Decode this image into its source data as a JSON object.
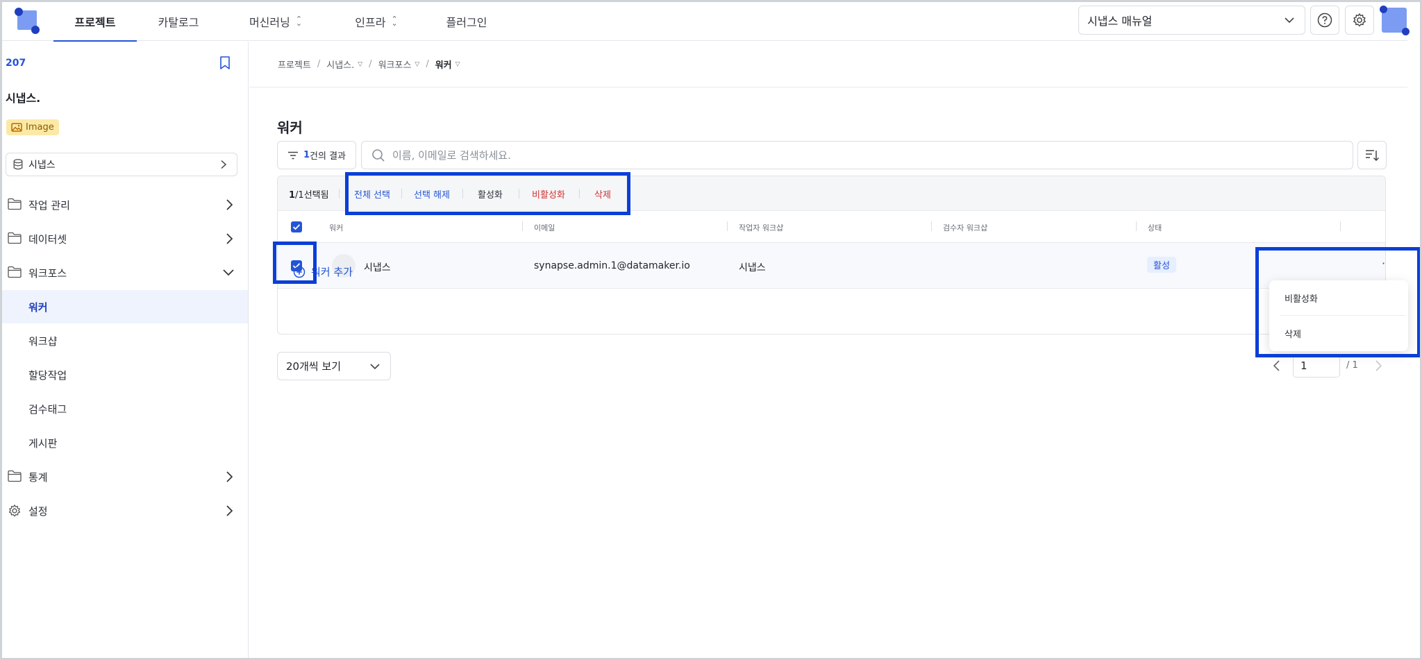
{
  "header": {
    "nav": [
      {
        "label": "프로젝트",
        "active": true,
        "dropdown": false
      },
      {
        "label": "카탈로그",
        "active": false,
        "dropdown": false
      },
      {
        "label": "머신러닝",
        "active": false,
        "dropdown": true
      },
      {
        "label": "인프라",
        "active": false,
        "dropdown": true
      },
      {
        "label": "플러그인",
        "active": false,
        "dropdown": false
      }
    ],
    "manual_select": "시냅스 매뉴얼"
  },
  "sidebar": {
    "project_id": "207",
    "project_name": "시냅스.",
    "badge": "Image",
    "dataset": "시냅스",
    "items": {
      "jobs": "작업 관리",
      "datasets": "데이터셋",
      "workforce": "워크포스",
      "workers": "워커",
      "workshops": "워크샵",
      "assignments": "할당작업",
      "review_tags": "검수태그",
      "board": "게시판",
      "stats": "통계",
      "settings": "설정"
    }
  },
  "breadcrumb": [
    "프로젝트",
    "시냅스.",
    "워크포스",
    "워커"
  ],
  "main": {
    "title": "워커",
    "filter": {
      "count": "1",
      "suffix": "건의 결과"
    },
    "search_placeholder": "이름, 이메일로 검색하세요.",
    "selection": {
      "selected": "1",
      "total": "/1",
      "suffix": "선택됨"
    },
    "bulk_actions": {
      "select_all": "전체 선택",
      "deselect": "선택 해제",
      "activate": "활성화",
      "deactivate": "비활성화",
      "delete": "삭제"
    },
    "columns": {
      "worker": "워커",
      "email": "이메일",
      "worker_workshop": "작업자 워크샵",
      "reviewer_workshop": "검수자 워크샵",
      "status": "상태"
    },
    "rows": [
      {
        "name": "시냅스",
        "email": "synapse.admin.1@datamaker.io",
        "worker_workshop": "시냅스",
        "reviewer_workshop": "",
        "status": "활성",
        "checked": true
      }
    ],
    "add_worker": "워커 추가",
    "page_size": "20개씩 보기",
    "pager": {
      "current": "1",
      "total": "/ 1"
    },
    "row_menu": {
      "deactivate": "비활성화",
      "delete": "삭제"
    }
  },
  "colors": {
    "accent": "#2454d6",
    "danger": "#d33030",
    "highlight": "#0b3fd6"
  }
}
